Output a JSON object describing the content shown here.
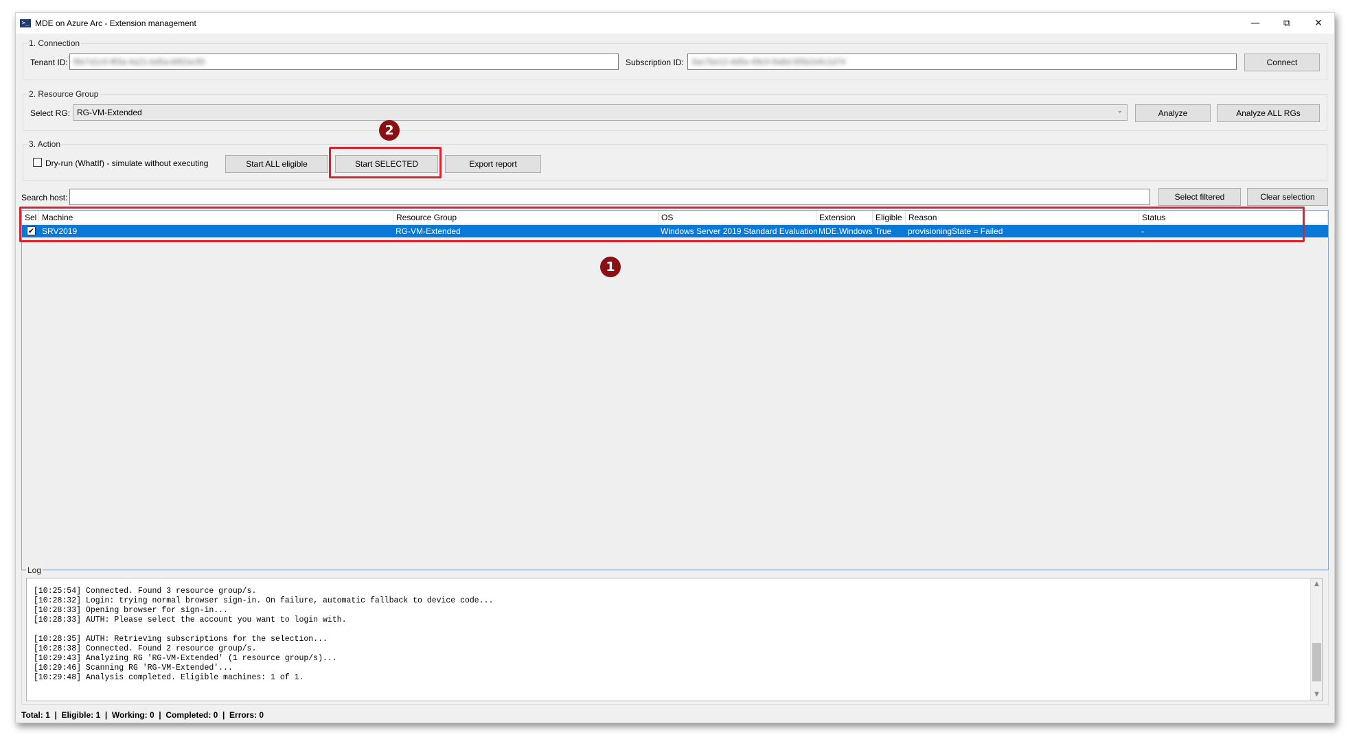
{
  "window": {
    "title": "MDE on Azure Arc - Extension management",
    "icon": "powershell-icon",
    "controls": [
      "minimize-icon",
      "restore-icon",
      "close-icon"
    ]
  },
  "connection": {
    "group_label": "1. Connection",
    "tenant_label": "Tenant ID:",
    "tenant_value": "f8e7d1c0-9f3a-4a21-bd5a-bf62ac90",
    "subscription_label": "Subscription ID:",
    "subscription_value": "3ac7be12-4d5e-49c0-9a8d-5f0b2e6c1d74",
    "connect_label": "Connect"
  },
  "resource_group": {
    "group_label": "2. Resource Group",
    "select_label": "Select RG:",
    "selected_value": "RG-VM-Extended",
    "analyze_label": "Analyze",
    "analyze_all_label": "Analyze ALL RGs"
  },
  "action": {
    "group_label": "3. Action",
    "dryrun_label": "Dry-run (WhatIf) - simulate without executing",
    "dryrun_checked": false,
    "start_all_label": "Start ALL eligible",
    "start_selected_label": "Start SELECTED",
    "export_label": "Export report"
  },
  "search": {
    "label": "Search host:",
    "value": "",
    "select_filtered_label": "Select filtered",
    "clear_selection_label": "Clear selection"
  },
  "grid": {
    "columns": [
      "Sel",
      "Machine",
      "Resource Group",
      "OS",
      "Extension",
      "Eligible",
      "Reason",
      "Status"
    ],
    "rows": [
      {
        "sel": true,
        "machine": "SRV2019",
        "resource_group": "RG-VM-Extended",
        "os": "Windows Server 2019 Standard Evaluation",
        "extension": "MDE.Windows",
        "eligible": "True",
        "reason": "provisioningState = Failed",
        "status": "-"
      }
    ],
    "selected_row_color": "#0a78d7"
  },
  "annotations": {
    "badge_1": "1",
    "badge_2": "2",
    "highlight_color": "#d9232d",
    "badge_color": "#8b1016"
  },
  "log": {
    "group_label": "Log",
    "lines": [
      "[10:25:54] Connected. Found 3 resource group/s.",
      "[10:28:32] Login: trying normal browser sign-in. On failure, automatic fallback to device code...",
      "[10:28:33] Opening browser for sign-in...",
      "[10:28:33] AUTH: Please select the account you want to login with.",
      "",
      "[10:28:35] AUTH: Retrieving subscriptions for the selection...",
      "[10:28:38] Connected. Found 2 resource group/s.",
      "[10:29:43] Analyzing RG 'RG-VM-Extended' (1 resource group/s)...",
      "[10:29:46] Scanning RG 'RG-VM-Extended'...",
      "[10:29:48] Analysis completed. Eligible machines: 1 of 1."
    ]
  },
  "status_bar": {
    "text": "Total: 1  |  Eligible: 1  |  Working: 0  |  Completed: 0  |  Errors: 0"
  }
}
